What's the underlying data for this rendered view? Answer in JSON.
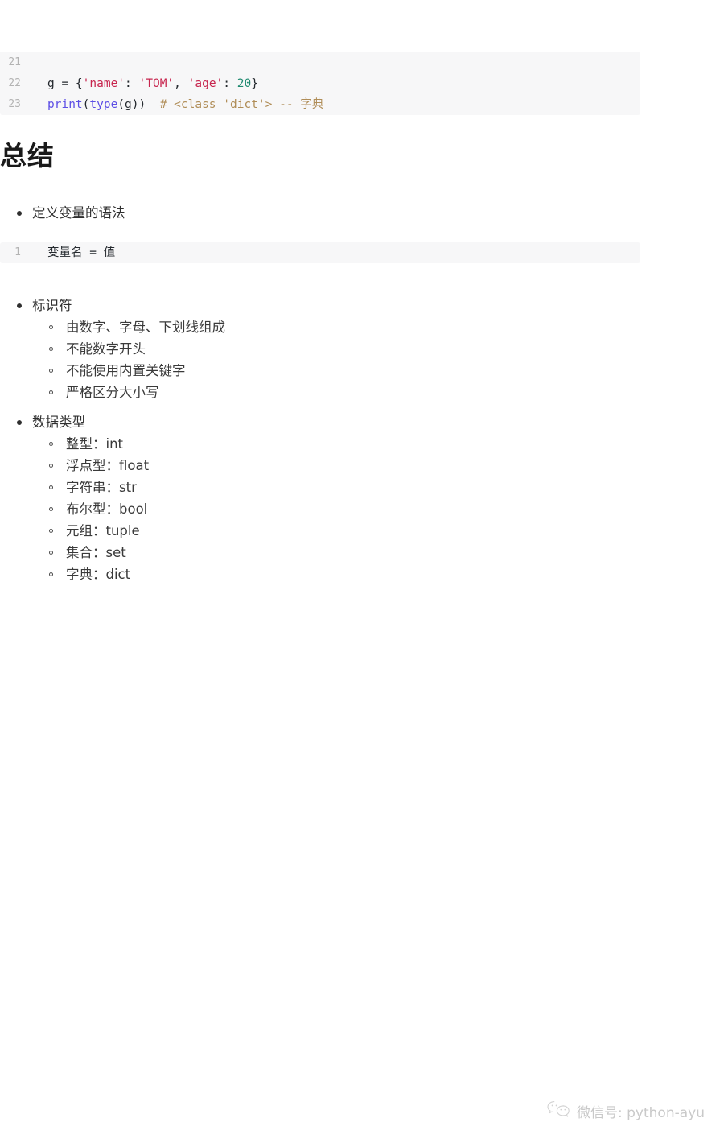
{
  "code_block_top": {
    "language": "python",
    "lines": [
      {
        "number": "21",
        "tokens": []
      },
      {
        "number": "22",
        "tokens": [
          {
            "t": "g = {",
            "c": "plain"
          },
          {
            "t": "'name'",
            "c": "str"
          },
          {
            "t": ": ",
            "c": "plain"
          },
          {
            "t": "'TOM'",
            "c": "str"
          },
          {
            "t": ", ",
            "c": "plain"
          },
          {
            "t": "'age'",
            "c": "str"
          },
          {
            "t": ": ",
            "c": "plain"
          },
          {
            "t": "20",
            "c": "num"
          },
          {
            "t": "}",
            "c": "plain"
          }
        ]
      },
      {
        "number": "23",
        "tokens": [
          {
            "t": "print",
            "c": "fn"
          },
          {
            "t": "(",
            "c": "plain"
          },
          {
            "t": "type",
            "c": "fn"
          },
          {
            "t": "(g))  ",
            "c": "plain"
          },
          {
            "t": "# <class 'dict'> -- 字典",
            "c": "com"
          }
        ]
      }
    ]
  },
  "heading": {
    "title": "总结"
  },
  "outline": [
    {
      "label": "定义变量的语法",
      "children": []
    },
    {
      "label": "标识符",
      "children": [
        "由数字、字母、下划线组成",
        "不能数字开头",
        "不能使用内置关键字",
        "严格区分大小写"
      ]
    },
    {
      "label": "数据类型",
      "children": [
        "整型：int",
        "浮点型：float",
        "字符串：str",
        "布尔型：bool",
        "元组：tuple",
        "集合：set",
        "字典：dict"
      ]
    }
  ],
  "code_block_syntax": {
    "language": "python",
    "lines": [
      {
        "number": "1",
        "tokens": [
          {
            "t": "变量名 = 值",
            "c": "plain"
          }
        ]
      }
    ]
  },
  "watermark": {
    "icon": "wechat-icon",
    "text": "微信号: python-ayu"
  },
  "colors": {
    "page_background": "#ffffff",
    "code_background": "#f7f7f8",
    "line_number": "#b3b3b3",
    "gutter_divider": "#e3e3e5",
    "text": "#2f2f2f",
    "heading": "#1a1a1a",
    "rule": "#ececec",
    "token_string": "#c7254e",
    "token_number": "#1f8a70",
    "token_function": "#5c4ee5",
    "token_comment": "#b08d57",
    "watermark": "#c9c9c9"
  }
}
